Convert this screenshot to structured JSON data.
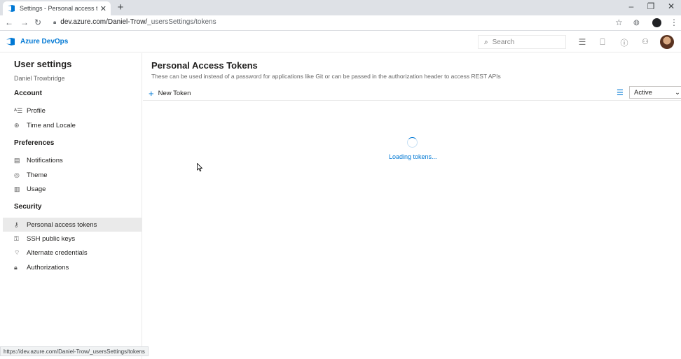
{
  "browser": {
    "tab_title": "Settings - Personal access tokens",
    "tab_close": "✕",
    "new_tab": "+",
    "url_host": "dev.azure.com/Daniel-Trow/",
    "url_path": "_usersSettings/tokens",
    "status_url": "https://dev.azure.com/Daniel-Trow/_usersSettings/tokens"
  },
  "header": {
    "brand": "Azure DevOps",
    "search_placeholder": "Search"
  },
  "sidebar": {
    "title": "User settings",
    "user_name": "Daniel Trowbridge",
    "sections": {
      "account": "Account",
      "preferences": "Preferences",
      "security": "Security"
    },
    "items": [
      {
        "label": "Profile",
        "icon": "profile-icon"
      },
      {
        "label": "Time and Locale",
        "icon": "globe-icon"
      },
      {
        "label": "Notifications",
        "icon": "notifications-icon"
      },
      {
        "label": "Theme",
        "icon": "theme-icon"
      },
      {
        "label": "Usage",
        "icon": "usage-icon"
      },
      {
        "label": "Personal access tokens",
        "icon": "tokens-icon",
        "active": true
      },
      {
        "label": "SSH public keys",
        "icon": "ssh-key-icon"
      },
      {
        "label": "Alternate credentials",
        "icon": "credentials-icon"
      },
      {
        "label": "Authorizations",
        "icon": "lock-icon"
      }
    ]
  },
  "main": {
    "title": "Personal Access Tokens",
    "description": "These can be used instead of a password for applications like Git or can be passed in the authorization header to access REST APIs",
    "new_token_label": "New Token",
    "filter_value": "Active",
    "loading_text": "Loading tokens..."
  },
  "colors": {
    "accent": "#0078d4",
    "active_item_bg": "#eaeaea"
  }
}
